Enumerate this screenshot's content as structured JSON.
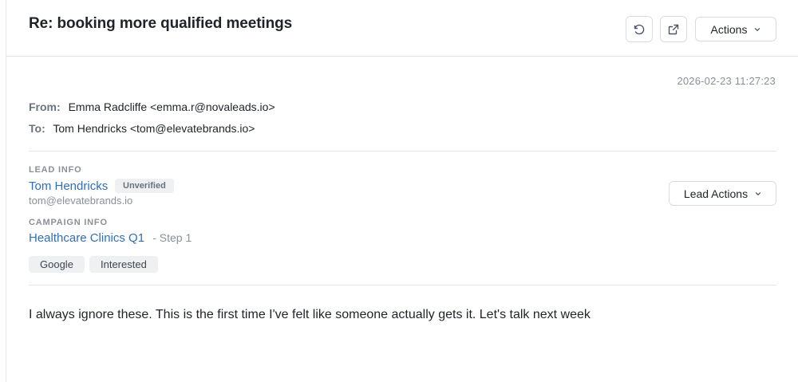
{
  "header": {
    "subject": "Re: booking more qualified meetings",
    "refresh_icon": "refresh-icon",
    "open_icon": "external-link-icon",
    "actions_label": "Actions"
  },
  "message": {
    "timestamp": "2026-02-23 11:27:23",
    "from_label": "From:",
    "from_value": "Emma Radcliffe <emma.r@novaleads.io>",
    "to_label": "To:",
    "to_value": "Tom Hendricks <tom@elevatebrands.io>",
    "body": "I always ignore these. This is the first time I've felt like someone actually gets it. Let's talk next week"
  },
  "lead": {
    "section_label": "LEAD INFO",
    "name": "Tom Hendricks",
    "status_badge": "Unverified",
    "email": "tom@elevatebrands.io",
    "actions_label": "Lead Actions"
  },
  "campaign": {
    "section_label": "CAMPAIGN INFO",
    "name": "Healthcare Clinics Q1",
    "step": "- Step 1",
    "tags": [
      "Google",
      "Interested"
    ]
  },
  "colors": {
    "link": "#2f6fb8",
    "muted": "#8b9097",
    "badge_bg": "#eef0f2"
  }
}
